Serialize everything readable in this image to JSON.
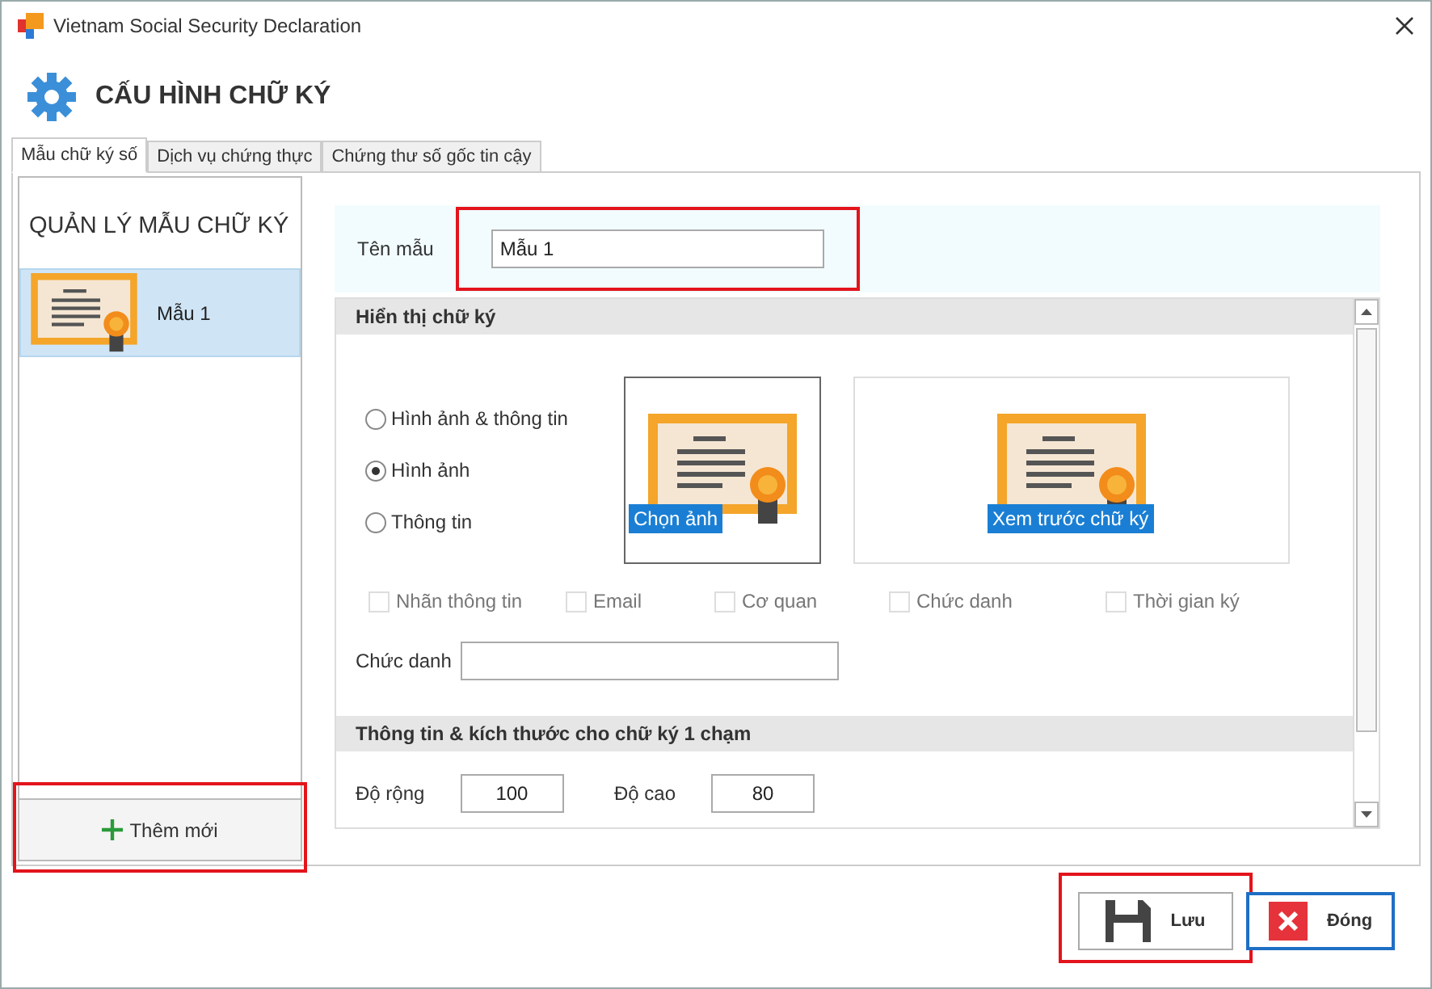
{
  "window": {
    "title": "Vietnam Social Security Declaration"
  },
  "header": {
    "title": "CẤU HÌNH CHỮ KÝ"
  },
  "tabs": [
    {
      "label": "Mẫu chữ ký số",
      "selected": true
    },
    {
      "label": "Dịch vụ chứng thực",
      "selected": false
    },
    {
      "label": "Chứng thư số gốc tin cậy",
      "selected": false
    }
  ],
  "templates": {
    "title": "QUẢN LÝ MẪU CHỮ KÝ",
    "items": [
      {
        "label": "Mẫu 1",
        "selected": true
      }
    ],
    "add_button": {
      "label": "Thêm mới",
      "highlighted": true
    }
  },
  "name_field": {
    "label": "Tên mẫu",
    "value": "Mẫu 1",
    "highlighted": true
  },
  "display": {
    "title": "Hiển thị chữ ký",
    "modes": [
      {
        "label": "Hình ảnh & thông tin",
        "selected": false
      },
      {
        "label": "Hình ảnh",
        "selected": true
      },
      {
        "label": "Thông tin",
        "selected": false
      }
    ],
    "choose_image": "Chọn ảnh",
    "preview": "Xem trước chữ ký",
    "options": [
      {
        "label": "Nhãn thông tin",
        "checked": false,
        "disabled": true
      },
      {
        "label": "Email",
        "checked": false,
        "disabled": true
      },
      {
        "label": "Cơ quan",
        "checked": false,
        "disabled": true
      },
      {
        "label": "Chức danh",
        "checked": false,
        "disabled": true
      },
      {
        "label": "Thời gian ký",
        "checked": false,
        "disabled": true
      }
    ],
    "position_field": {
      "label": "Chức danh"
    }
  },
  "size": {
    "title": "Thông tin & kích thước cho chữ ký 1 chạm",
    "fields": [
      {
        "label": "Độ rộng",
        "value": "100"
      },
      {
        "label": "Độ cao",
        "value": "80"
      }
    ]
  },
  "buttons": [
    {
      "label": "Lưu",
      "kind": "save",
      "highlighted": true,
      "focused": false
    },
    {
      "label": "Đóng",
      "kind": "close",
      "highlighted": false,
      "focused": true
    }
  ]
}
